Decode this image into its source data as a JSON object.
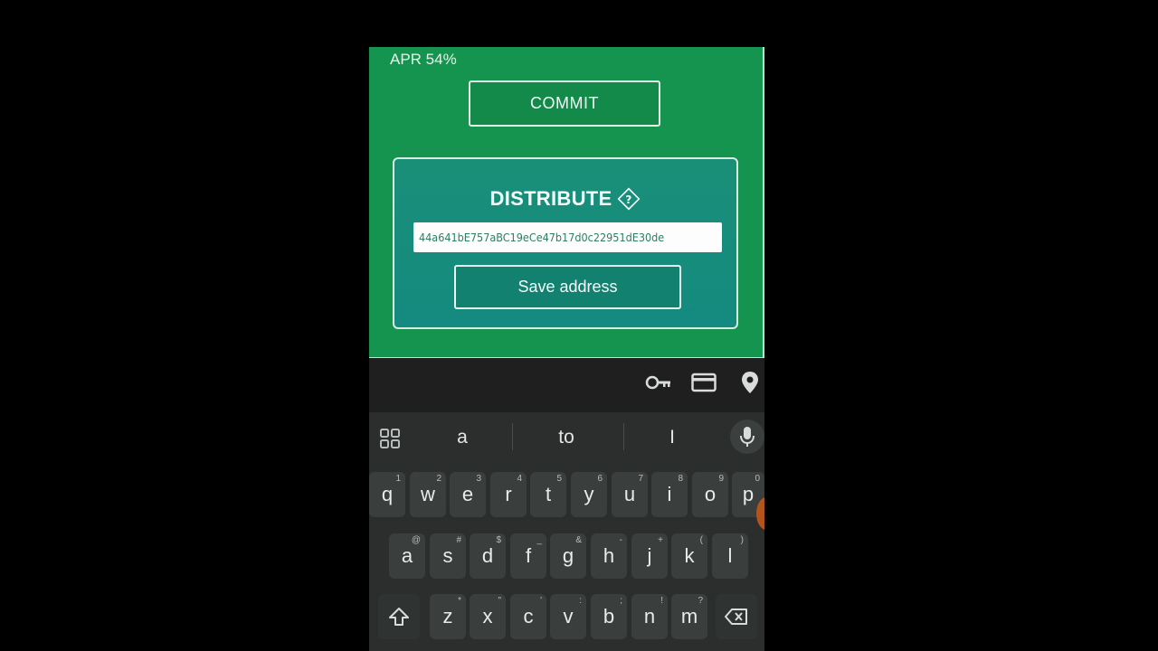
{
  "app": {
    "apr_label": "APR 54%",
    "commit_label": "COMMIT",
    "distribute_title": "DISTRIBUTE",
    "address_value": "44a641bE757aBC19eCe47b17d0c22951dE30de",
    "save_label": "Save address"
  },
  "autofill": {
    "icons": [
      "key-icon",
      "credit-card-icon",
      "location-pin-icon"
    ]
  },
  "keyboard": {
    "suggestions": [
      "a",
      "to",
      "I"
    ],
    "row1": [
      {
        "k": "q",
        "h": "1"
      },
      {
        "k": "w",
        "h": "2"
      },
      {
        "k": "e",
        "h": "3"
      },
      {
        "k": "r",
        "h": "4"
      },
      {
        "k": "t",
        "h": "5"
      },
      {
        "k": "y",
        "h": "6"
      },
      {
        "k": "u",
        "h": "7"
      },
      {
        "k": "i",
        "h": "8"
      },
      {
        "k": "o",
        "h": "9"
      },
      {
        "k": "p",
        "h": "0"
      }
    ],
    "row2": [
      {
        "k": "a",
        "h": "@"
      },
      {
        "k": "s",
        "h": "#"
      },
      {
        "k": "d",
        "h": "$"
      },
      {
        "k": "f",
        "h": "_"
      },
      {
        "k": "g",
        "h": "&"
      },
      {
        "k": "h",
        "h": "-"
      },
      {
        "k": "j",
        "h": "+"
      },
      {
        "k": "k",
        "h": "("
      },
      {
        "k": "l",
        "h": ")"
      }
    ],
    "row3": [
      {
        "k": "z",
        "h": "*"
      },
      {
        "k": "x",
        "h": "\""
      },
      {
        "k": "c",
        "h": "'"
      },
      {
        "k": "v",
        "h": ":"
      },
      {
        "k": "b",
        "h": ";"
      },
      {
        "k": "n",
        "h": "!"
      },
      {
        "k": "m",
        "h": "?"
      }
    ]
  },
  "colors": {
    "app_green": "#14944f",
    "card_teal": "#148a80",
    "keyboard_bg": "#2b2e2d"
  }
}
